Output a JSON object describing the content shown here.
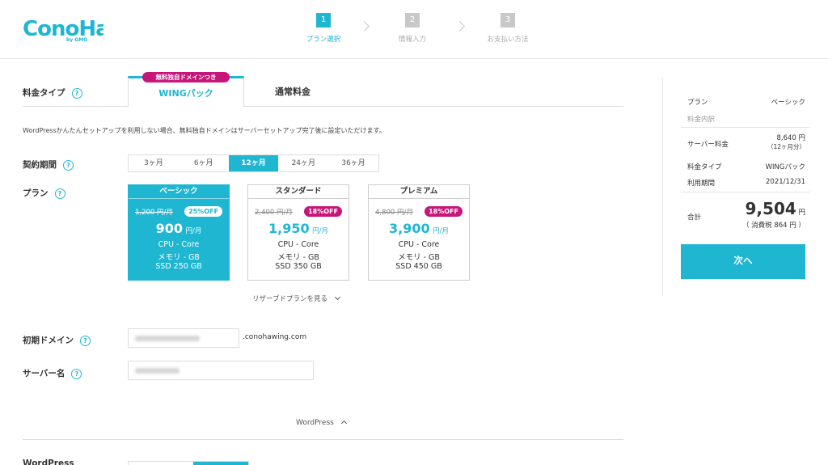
{
  "brand": {
    "name": "ConoHa",
    "byline": "by GMO",
    "color": "#1fb6d2",
    "accent_pink": "#c8157a"
  },
  "steps": [
    {
      "num": "1",
      "label": "プラン選択"
    },
    {
      "num": "2",
      "label": "情報入力"
    },
    {
      "num": "3",
      "label": "お支払い方法"
    }
  ],
  "rate_type": {
    "label": "料金タイプ",
    "tab_wing": "WINGパック",
    "tab_badge": "無料独自ドメインつき",
    "tab_normal": "通常料金"
  },
  "notice": "WordPressかんたんセットアップを利用しない場合、無料独自ドメインはサーバーセットアップ完了後に設定いただけます。",
  "period": {
    "label": "契約期間",
    "options": [
      "3ヶ月",
      "6ヶ月",
      "12ヶ月",
      "24ヶ月",
      "36ヶ月"
    ],
    "selected": "12ヶ月"
  },
  "plan_label": "プラン",
  "plans": [
    {
      "name": "ベーシック",
      "old": "1,200 円/月",
      "badge": "25%OFF",
      "price": "900",
      "unit": "円/月",
      "cpu": "CPU - Core",
      "mem": "メモリ - GB",
      "ssd": "SSD 250 GB"
    },
    {
      "name": "スタンダード",
      "old": "2,400 円/月",
      "badge": "18%OFF",
      "price": "1,950",
      "unit": "円/月",
      "cpu": "CPU - Core",
      "mem": "メモリ - GB",
      "ssd": "SSD 350 GB"
    },
    {
      "name": "プレミアム",
      "old": "4,800 円/月",
      "badge": "18%OFF",
      "price": "3,900",
      "unit": "円/月",
      "cpu": "CPU - Core",
      "mem": "メモリ - GB",
      "ssd": "SSD 450 GB"
    }
  ],
  "reserve_link": "リザーブドプランを見る",
  "domain": {
    "label": "初期ドメイン",
    "suffix": ".conohawing.com"
  },
  "server_name": {
    "label": "サーバー名"
  },
  "wordpress_toggle": "WordPress",
  "wordpress_label": "WordPress",
  "summary": {
    "plan_k": "プラン",
    "plan_v": "ベーシック",
    "breakdown": "料金内訳",
    "server_fee_k": "サーバー料金",
    "server_fee_v": "8,640 円",
    "server_fee_note": "（12ヶ月分）",
    "type_k": "料金タイプ",
    "type_v": "WINGパック",
    "period_k": "利用期間",
    "period_v": "2021/12/31",
    "total_k": "合計",
    "total_v": "9,504",
    "total_unit": "円",
    "tax": "（ 消費税 864 円 ）",
    "next_button": "次へ"
  }
}
